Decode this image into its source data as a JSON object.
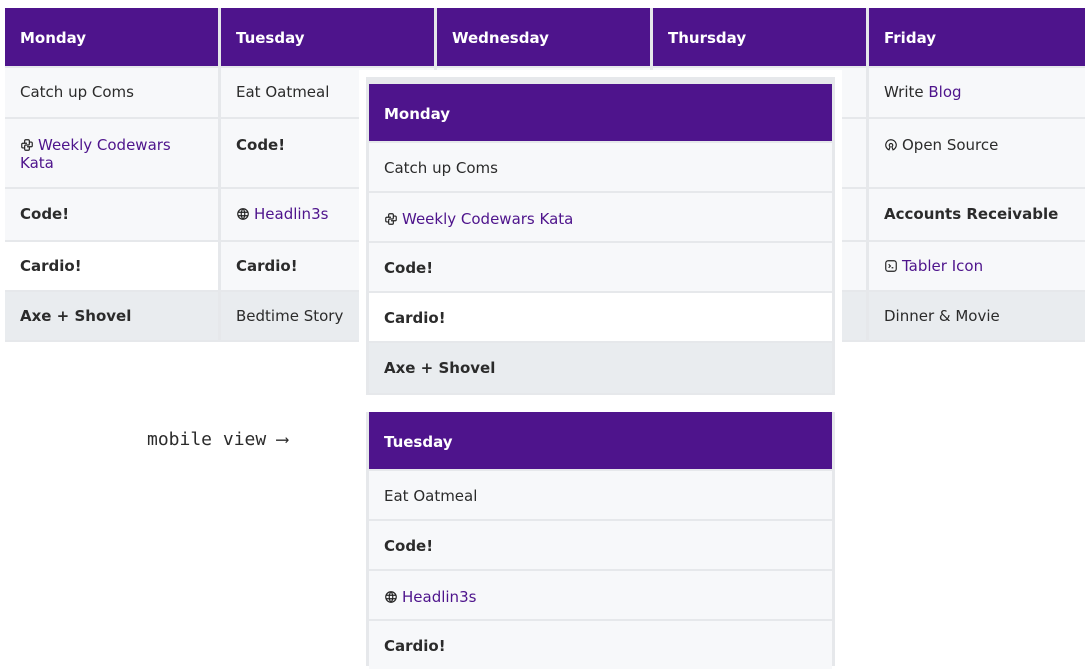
{
  "desktop": {
    "days": [
      {
        "label": "Monday",
        "items": [
          {
            "text": "Catch up Coms"
          },
          {
            "icon": "python-icon",
            "link": "Weekly Codewars Kata"
          },
          {
            "text": "Code!"
          },
          {
            "text": "Cardio!"
          },
          {
            "text": "Axe + Shovel"
          }
        ]
      },
      {
        "label": "Tuesday",
        "items": [
          {
            "text": "Eat Oatmeal"
          },
          {
            "text": "Code!"
          },
          {
            "icon": "globe-icon",
            "link": "Headlin3s"
          },
          {
            "text": "Cardio!"
          },
          {
            "text": "Bedtime Story"
          }
        ]
      },
      {
        "label": "Wednesday"
      },
      {
        "label": "Thursday"
      },
      {
        "label": "Friday",
        "items": [
          {
            "text": "Write",
            "link": "Blog"
          },
          {
            "icon": "open-source-icon",
            "text": "Open Source"
          },
          {
            "text": "Accounts Receivable"
          },
          {
            "icon": "terminal-icon",
            "link": "Tabler Icon"
          },
          {
            "text": "Dinner & Movie"
          }
        ]
      }
    ]
  },
  "mobile": {
    "note": "mobile view ⟶",
    "monday": {
      "label": "Monday",
      "items": [
        "Catch up Coms",
        "Weekly Codewars Kata",
        "Code!",
        "Cardio!",
        "Axe + Shovel"
      ]
    },
    "tuesday": {
      "label": "Tuesday",
      "items": [
        "Eat Oatmeal",
        "Code!",
        "Headlin3s",
        "Cardio!"
      ]
    }
  }
}
